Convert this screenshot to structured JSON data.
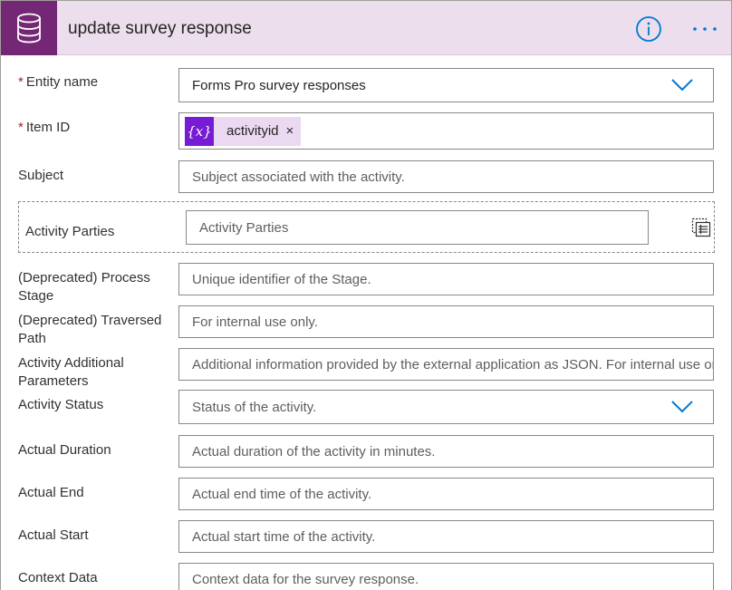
{
  "header": {
    "title": "update survey response",
    "icon": "database-icon",
    "info_icon": "info-icon",
    "more_icon": "more-icon",
    "accent_color": "#742774",
    "header_bg": "#ecdeec"
  },
  "fields": {
    "entity_name": {
      "label": "Entity name",
      "required": "*",
      "value": "Forms Pro survey responses"
    },
    "item_id": {
      "label": "Item ID",
      "required": "*",
      "token_symbol": "{x}",
      "token_label": "activityid",
      "token_remove": "×"
    },
    "subject": {
      "label": "Subject",
      "placeholder": "Subject associated with the activity."
    },
    "activity_parties": {
      "label": "Activity Parties",
      "placeholder": "Activity Parties",
      "icon": "array-input-icon"
    },
    "process_stage": {
      "label": "(Deprecated) Process Stage",
      "placeholder": "Unique identifier of the Stage."
    },
    "traversed_path": {
      "label": "(Deprecated) Traversed Path",
      "placeholder": "For internal use only."
    },
    "additional_params": {
      "label": "Activity Additional Parameters",
      "placeholder": "Additional information provided by the external application as JSON. For internal use only."
    },
    "activity_status": {
      "label": "Activity Status",
      "placeholder": "Status of the activity."
    },
    "actual_duration": {
      "label": "Actual Duration",
      "placeholder": "Actual duration of the activity in minutes."
    },
    "actual_end": {
      "label": "Actual End",
      "placeholder": "Actual end time of the activity."
    },
    "actual_start": {
      "label": "Actual Start",
      "placeholder": "Actual start time of the activity."
    },
    "context_data": {
      "label": "Context Data",
      "placeholder": "Context data for the survey response."
    }
  }
}
